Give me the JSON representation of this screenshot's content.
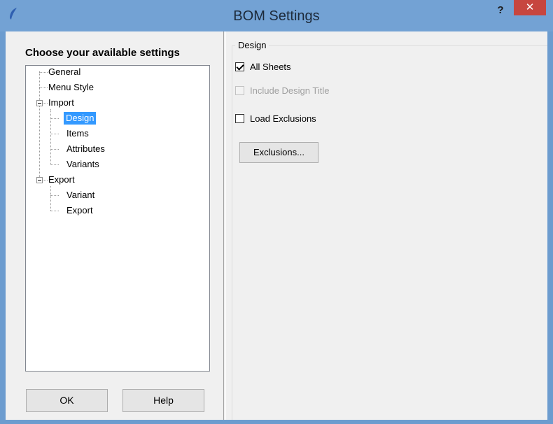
{
  "window": {
    "title": "BOM Settings",
    "help_glyph": "?",
    "close_glyph": "✕"
  },
  "left": {
    "heading": "Choose your available settings",
    "tree": [
      {
        "label": "General",
        "level": 0
      },
      {
        "label": "Menu Style",
        "level": 0
      },
      {
        "label": "Import",
        "level": 0,
        "expanded": true
      },
      {
        "label": "Design",
        "level": 1,
        "selected": true
      },
      {
        "label": "Items",
        "level": 1
      },
      {
        "label": "Attributes",
        "level": 1
      },
      {
        "label": "Variants",
        "level": 1
      },
      {
        "label": "Export",
        "level": 0,
        "expanded": true
      },
      {
        "label": "Variant",
        "level": 1
      },
      {
        "label": "Export",
        "level": 1
      }
    ],
    "ok_label": "OK",
    "help_label": "Help"
  },
  "right": {
    "group_title": "Design",
    "all_sheets": {
      "label": "All Sheets",
      "checked": true
    },
    "include_design_title": {
      "label": "Include Design Title",
      "checked": false,
      "disabled": true
    },
    "load_exclusions": {
      "label": "Load Exclusions",
      "checked": false
    },
    "exclusions_button": "Exclusions..."
  },
  "colors": {
    "titlebar": "#73a2d4",
    "close": "#c7463f",
    "selection": "#3399ff"
  }
}
